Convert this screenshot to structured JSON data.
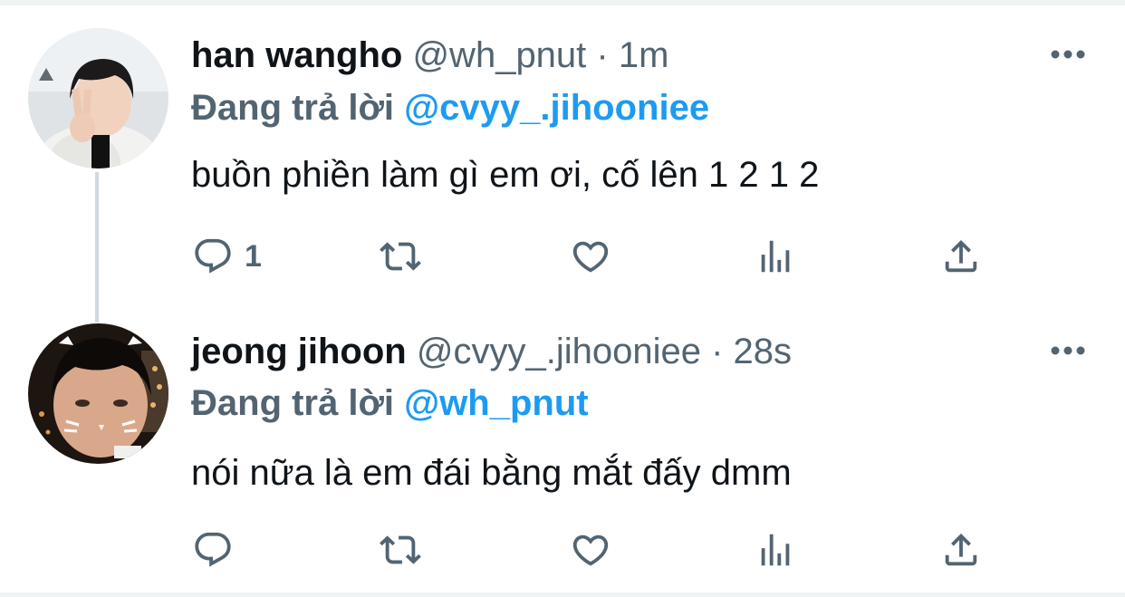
{
  "colors": {
    "link": "#1d9bf0",
    "secondary": "#536471",
    "text": "#0f1419",
    "divider": "#eff3f4",
    "thread": "#cfd9de"
  },
  "tweets": [
    {
      "name": "han wangho",
      "handle": "@wh_pnut",
      "separator": "·",
      "time": "1m",
      "reply_prefix": "Đang trả lời",
      "reply_handle": "@cvyy_.jihooniee",
      "text": "buồn phiền làm gì em ơi, cố lên 1 2 1 2",
      "reply_count": "1",
      "icons": [
        "more-icon",
        "reply-icon",
        "retweet-icon",
        "like-icon",
        "views-icon",
        "share-icon"
      ]
    },
    {
      "name": "jeong jihoon",
      "handle": "@cvyy_.jihooniee",
      "separator": "·",
      "time": "28s",
      "reply_prefix": "Đang trả lời",
      "reply_handle": "@wh_pnut",
      "text": "nói nữa là em đái bằng mắt đấy dmm",
      "reply_count": "",
      "icons": [
        "more-icon",
        "reply-icon",
        "retweet-icon",
        "like-icon",
        "views-icon",
        "share-icon"
      ]
    }
  ]
}
